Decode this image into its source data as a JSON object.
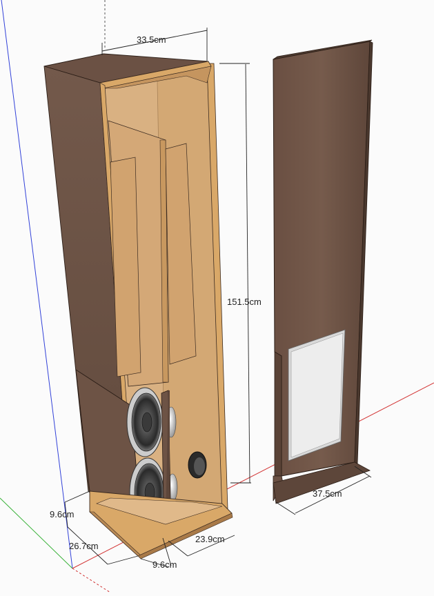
{
  "dimensions": {
    "top_width": "33.5cm",
    "height": "151.5cm",
    "door_width": "37.5cm",
    "plinth_height": "9.6cm",
    "depth": "26.7cm",
    "front_gap": "9.6cm",
    "bottom_inner": "23.9cm"
  },
  "colors": {
    "background": "#fbfbfb",
    "walnut": "#6e5446",
    "walnut_dark": "#4b3a31",
    "mdf": "#d6ad7c",
    "mdf_edge": "#c89a5e",
    "glass": "#ececec",
    "axis_red": "#d22",
    "axis_green": "#2a2",
    "axis_blue": "#22c"
  }
}
